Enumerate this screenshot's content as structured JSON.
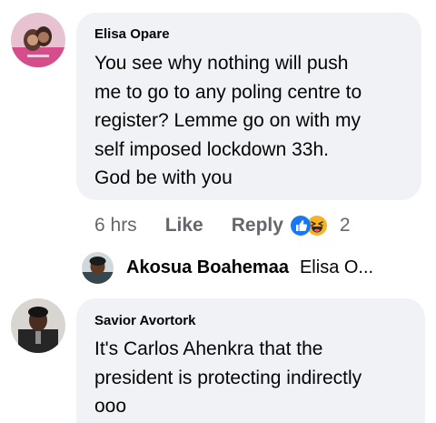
{
  "comments": [
    {
      "author": "Elisa Opare",
      "text_lines": [
        "You see why nothing will push",
        "me to go to any poling centre to",
        "register? Lemme go on with my",
        "self imposed lockdown 33h.",
        "God be with you"
      ],
      "time": "6 hrs",
      "like_label": "Like",
      "reply_label": "Reply",
      "reactions": [
        "like-reaction-icon",
        "haha-reaction-icon"
      ],
      "reaction_count": "2",
      "reply_preview": {
        "author": "Akosua Boahemaa",
        "snippet": "Elisa O..."
      }
    },
    {
      "author": "Savior Avortork",
      "text_lines": [
        "It's Carlos Ahenkra that the",
        "president is protecting indirectly",
        "ooo"
      ]
    }
  ],
  "colors": {
    "bubble_bg": "#f0f2f5",
    "meta_gray": "#65676b",
    "like_blue": "#1877f2",
    "haha_yellow": "#f7b125"
  }
}
